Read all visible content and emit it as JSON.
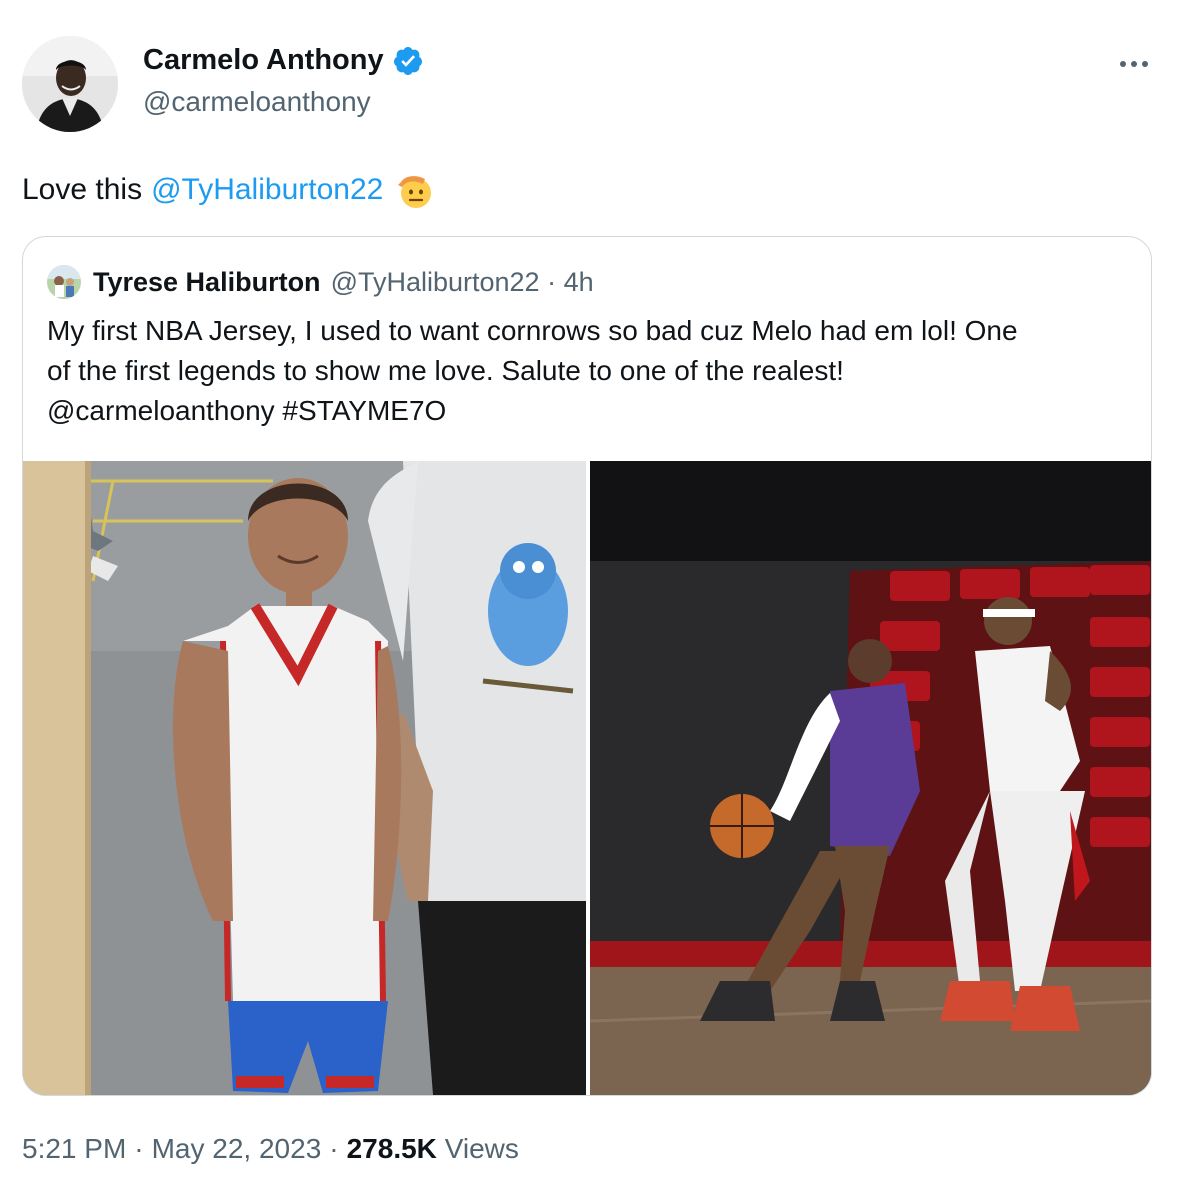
{
  "author": {
    "name": "Carmelo Anthony",
    "handle": "@carmeloanthony",
    "verified": true,
    "badge_color": "#1d9bf0"
  },
  "more_icon": "more-horizontal-icon",
  "tweet": {
    "text_prefix": "Love this",
    "mention": "@TyHaliburton22",
    "emoji": "salute-emoji",
    "link_color": "#1d9bf0"
  },
  "quoted_tweet": {
    "name": "Tyrese Haliburton",
    "handle": "@TyHaliburton22",
    "time": "4h",
    "text": "My first NBA Jersey, I used to want cornrows so bad cuz Melo had em lol! One\nof the first legends to show me love. Salute to one of the realest!\n@carmeloanthony #STAYME7O",
    "media": [
      "childhood-jersey-photo",
      "game-action-photo"
    ]
  },
  "footer": {
    "time": "5:21 PM",
    "date": "May 22, 2023",
    "views_count": "278.5K",
    "views_label": "Views"
  }
}
